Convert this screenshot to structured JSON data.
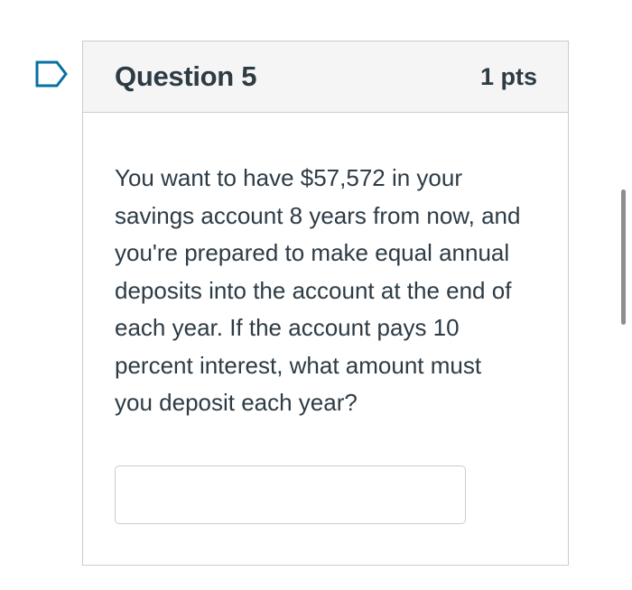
{
  "question": {
    "title": "Question 5",
    "points": "1 pts",
    "text": "You want to have $57,572 in your savings account 8 years from now, and you're prepared to make equal annual deposits into the account at the end of each year. If the account pays 10 percent interest, what amount must you deposit each year?",
    "answer_value": "",
    "answer_placeholder": ""
  },
  "icons": {
    "flag": "bookmark-flag-icon"
  },
  "colors": {
    "flag_stroke": "#0770a3",
    "header_bg": "#f5f5f5",
    "border": "#c7cdd1",
    "text": "#2d3b45"
  }
}
